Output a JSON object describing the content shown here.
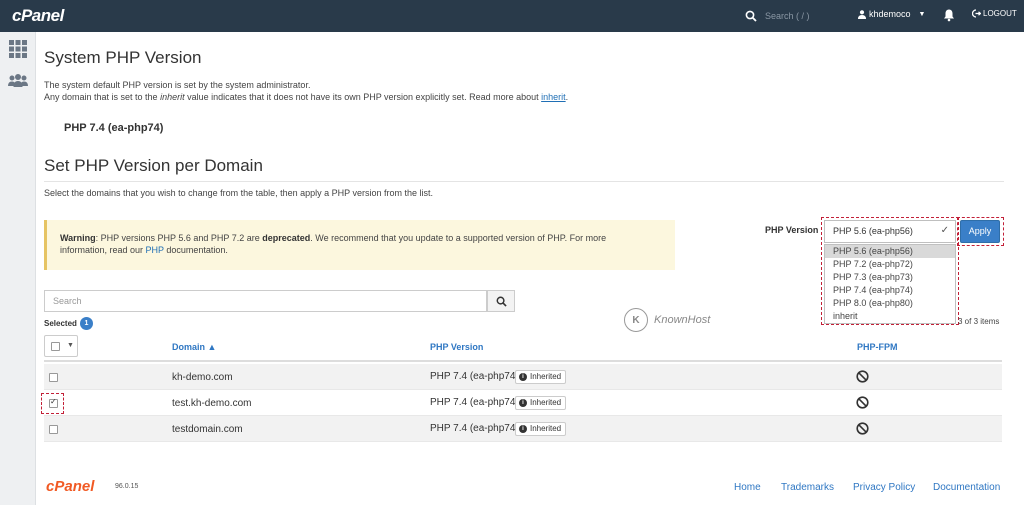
{
  "topbar": {
    "logo": "cPanel",
    "search_placeholder": "Search ( / )",
    "username": "khdemoco",
    "logout_label": "LOGOUT"
  },
  "sidebar": {
    "items": [
      {
        "icon": "grid-icon"
      },
      {
        "icon": "users-icon"
      }
    ]
  },
  "page": {
    "title": "System PHP Version",
    "desc_line1": "The system default PHP version is set by the system administrator.",
    "desc_line2_a": "Any domain that is set to the ",
    "desc_line2_em": "inherit",
    "desc_line2_b": " value indicates that it does not have its own PHP version explicitly set. Read more about ",
    "desc_link": "inherit",
    "desc_line2_end": ".",
    "current_version": "PHP 7.4 (ea-php74)"
  },
  "per_domain": {
    "title": "Set PHP Version per Domain",
    "description": "Select the domains that you wish to change from the table, then apply a PHP version from the list."
  },
  "warning": {
    "label": "Warning",
    "text_a": ": PHP versions PHP 5.6 and PHP 7.2 are ",
    "text_bold": "deprecated",
    "text_b": ". We recommend that you update to a supported version of PHP. For more",
    "text_c": "information, read our ",
    "link": "PHP",
    "text_d": " documentation."
  },
  "php_selector": {
    "label": "PHP Version",
    "selected": "PHP 5.6 (ea-php56)",
    "apply_label": "Apply",
    "options": [
      "PHP 5.6 (ea-php56)",
      "PHP 7.2 (ea-php72)",
      "PHP 7.3 (ea-php73)",
      "PHP 7.4 (ea-php74)",
      "PHP 8.0 (ea-php80)",
      "inherit"
    ]
  },
  "search": {
    "placeholder": "Search"
  },
  "selection": {
    "label": "Selected",
    "count": "1"
  },
  "watermark": "KnownHost",
  "items_count": "3 of 3 items",
  "table": {
    "columns": {
      "domain": "Domain ▲",
      "php_version": "PHP Version",
      "php_fpm": "PHP-FPM"
    },
    "rows": [
      {
        "domain": "kh-demo.com",
        "version": "PHP 7.4 (ea-php74)",
        "badge": "Inherited",
        "checked": false
      },
      {
        "domain": "test.kh-demo.com",
        "version": "PHP 7.4 (ea-php74)",
        "badge": "Inherited",
        "checked": true
      },
      {
        "domain": "testdomain.com",
        "version": "PHP 7.4 (ea-php74)",
        "badge": "Inherited",
        "checked": false
      }
    ]
  },
  "footer": {
    "logo": "cPanel",
    "version": "96.0.15",
    "links": [
      "Home",
      "Trademarks",
      "Privacy Policy",
      "Documentation"
    ]
  },
  "colors": {
    "topbar": "#293a4a",
    "link": "#2f77c3",
    "apply": "#3a7fc8",
    "highlight": "#c21f37",
    "footer_logo": "#f15a24"
  }
}
